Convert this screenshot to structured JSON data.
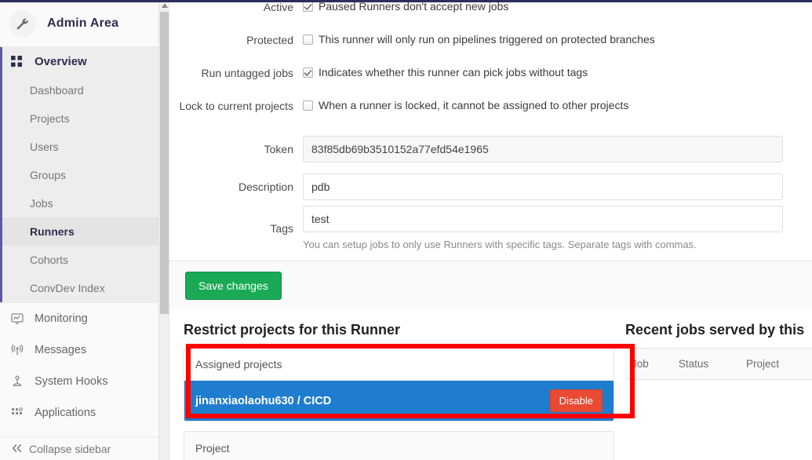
{
  "sidebar": {
    "brand": {
      "icon": "wrench-icon",
      "title": "Admin Area"
    },
    "group": {
      "icon": "grid-icon",
      "label": "Overview",
      "items": [
        {
          "label": "Dashboard",
          "active": false
        },
        {
          "label": "Projects",
          "active": false
        },
        {
          "label": "Users",
          "active": false
        },
        {
          "label": "Groups",
          "active": false
        },
        {
          "label": "Jobs",
          "active": false
        },
        {
          "label": "Runners",
          "active": true
        },
        {
          "label": "Cohorts",
          "active": false
        },
        {
          "label": "ConvDev Index",
          "active": false
        }
      ]
    },
    "links": [
      {
        "label": "Monitoring",
        "icon": "monitor-icon"
      },
      {
        "label": "Messages",
        "icon": "broadcast-icon"
      },
      {
        "label": "System Hooks",
        "icon": "hook-icon"
      },
      {
        "label": "Applications",
        "icon": "apps-icon"
      }
    ],
    "collapse": {
      "label": "Collapse sidebar",
      "icon": "chevron-double-left-icon"
    }
  },
  "form": {
    "checkboxes": [
      {
        "label": "Active",
        "text": "Paused Runners don't accept new jobs",
        "checked": true
      },
      {
        "label": "Protected",
        "text": "This runner will only run on pipelines triggered on protected branches",
        "checked": false
      },
      {
        "label": "Run untagged jobs",
        "text": "Indicates whether this runner can pick jobs without tags",
        "checked": true
      },
      {
        "label": "Lock to current projects",
        "text": "When a runner is locked, it cannot be assigned to other projects",
        "checked": false
      }
    ],
    "fields": [
      {
        "label": "Token",
        "value": "83f85db69b3510152a77efd54e1965",
        "readonly": true,
        "placeholder": ""
      },
      {
        "label": "Description",
        "value": "pdb",
        "readonly": false,
        "placeholder": ""
      },
      {
        "label": "Tags",
        "value": "test",
        "readonly": false,
        "placeholder": ""
      }
    ],
    "tags_help": "You can setup jobs to only use Runners with specific tags. Separate tags with commas.",
    "save_label": "Save changes"
  },
  "restrict": {
    "title": "Restrict projects for this Runner",
    "assigned_header": "Assigned projects",
    "assigned_project": "jinanxiaolaohu630 / CICD",
    "disable_label": "Disable",
    "project_header": "Project"
  },
  "recent_jobs": {
    "title": "Recent jobs served by this",
    "columns": [
      "Job",
      "Status",
      "Project"
    ]
  },
  "colors": {
    "accent_blue": "#1f7dd0",
    "danger_red": "#e94a34",
    "success_green": "#1aaa55",
    "highlight_box": "#ff0000",
    "sidebar_accent": "#5b5ba5"
  }
}
